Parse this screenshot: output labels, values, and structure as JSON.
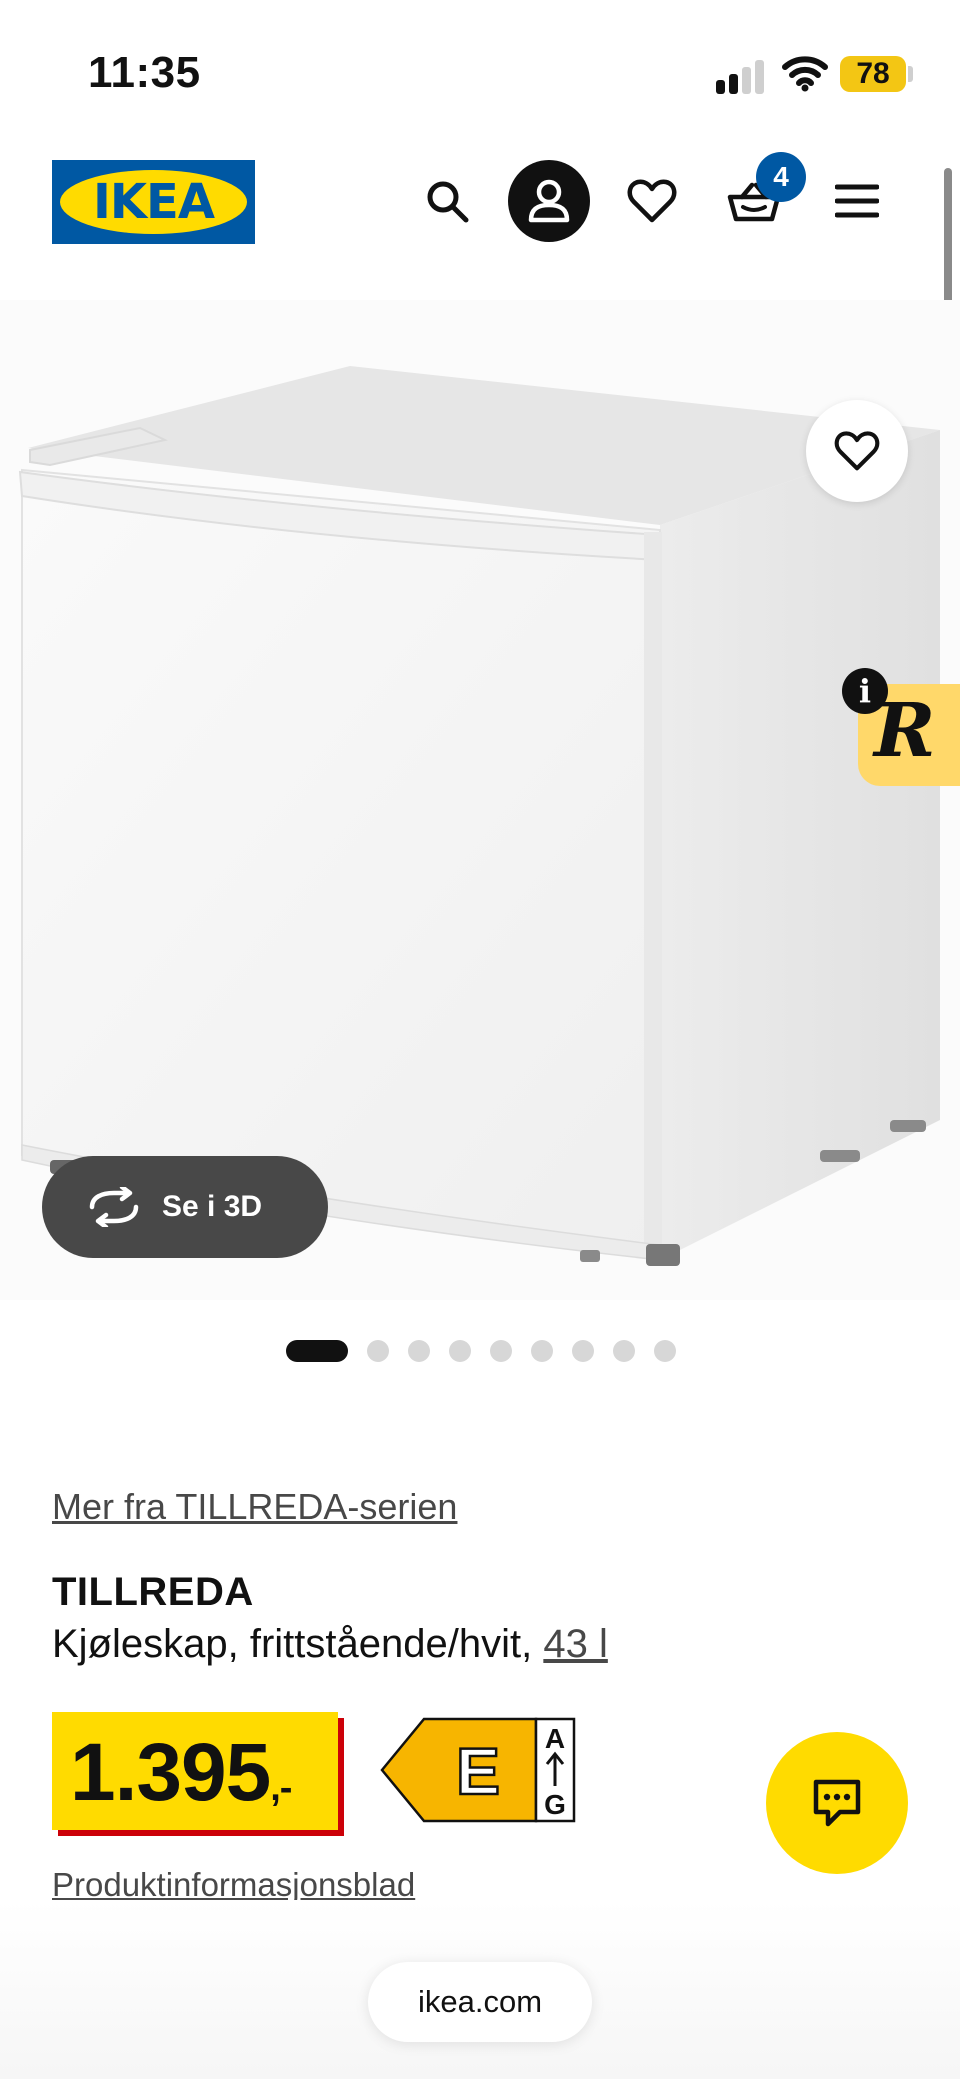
{
  "status_bar": {
    "time": "11:35",
    "battery": "78",
    "icons": [
      "cellular-signal-icon",
      "wifi-icon",
      "battery-icon"
    ]
  },
  "header": {
    "logo_text": "IKEA",
    "logo_colors": {
      "blue": "#0058a3",
      "yellow": "#ffdb00"
    },
    "icons": [
      "search-icon",
      "profile-icon",
      "heart-icon",
      "basket-icon",
      "menu-icon"
    ],
    "cart_count": "4"
  },
  "gallery": {
    "view_3d_label": "Se i 3D",
    "image_count": 9,
    "active_index": 0
  },
  "widget": {
    "letter": "R",
    "info_label": "i",
    "color": "#ffd86a"
  },
  "product": {
    "series_link": "Mer fra TILLREDA-serien",
    "name": "TILLREDA",
    "description": "Kjøleskap, frittstående/hvit,",
    "volume": "43 l",
    "price_main": "1.395",
    "price_suffix": ",-",
    "energy_class": "E",
    "energy_scale_top": "A",
    "energy_scale_bottom": "G",
    "info_sheet_link": "Produktinformasjonsblad"
  },
  "browser": {
    "url": "ikea.com"
  },
  "colors": {
    "accent_yellow": "#ffdb00",
    "price_shadow_red": "#cc0008",
    "brand_blue": "#0058a3"
  }
}
